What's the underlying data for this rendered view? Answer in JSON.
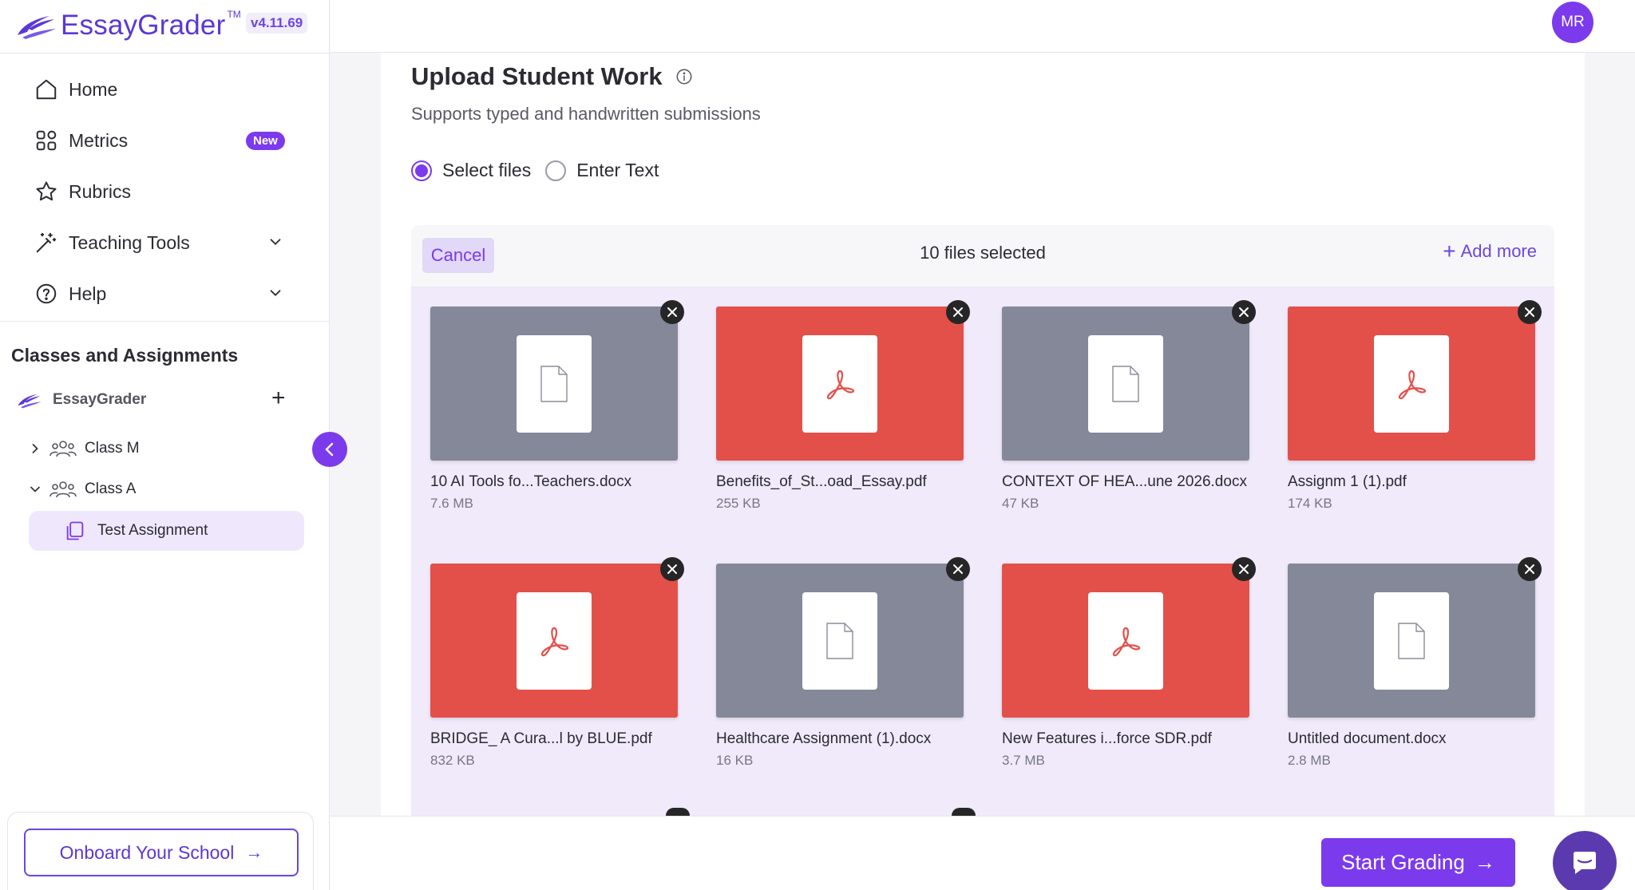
{
  "app": {
    "name": "EssayGrader",
    "trademark": "TM",
    "version": "v4.11.69",
    "brand_color": "#7c3aed"
  },
  "user": {
    "initials": "MR"
  },
  "sidebar": {
    "nav": [
      {
        "label": "Home",
        "icon": "home-icon"
      },
      {
        "label": "Metrics",
        "icon": "grid-icon",
        "badge": "New"
      },
      {
        "label": "Rubrics",
        "icon": "star-icon"
      },
      {
        "label": "Teaching Tools",
        "icon": "magic-wand-icon",
        "expandable": true
      },
      {
        "label": "Help",
        "icon": "help-circle-icon",
        "expandable": true
      }
    ],
    "classes_title": "Classes and Assignments",
    "tree_root": "EssayGrader",
    "classes": [
      {
        "label": "Class M",
        "expanded": false
      },
      {
        "label": "Class A",
        "expanded": true
      }
    ],
    "active_assignment": "Test Assignment",
    "onboard_label": "Onboard Your School"
  },
  "main": {
    "title": "Upload Student Work",
    "subtitle": "Supports typed and handwritten submissions",
    "radio_options": [
      {
        "label": "Select files",
        "selected": true
      },
      {
        "label": "Enter Text",
        "selected": false
      }
    ],
    "files_panel": {
      "cancel_label": "Cancel",
      "selected_text": "10 files selected",
      "add_more_label": "Add more"
    },
    "files": [
      {
        "name": "10 AI Tools fo...Teachers.docx",
        "size": "7.6 MB",
        "kind": "doc"
      },
      {
        "name": "Benefits_of_St...oad_Essay.pdf",
        "size": "255 KB",
        "kind": "pdf"
      },
      {
        "name": "CONTEXT OF HEA...une 2026.docx",
        "size": "47 KB",
        "kind": "doc"
      },
      {
        "name": "Assignm 1 (1).pdf",
        "size": "174 KB",
        "kind": "pdf"
      },
      {
        "name": "BRIDGE_ A Cura...l by BLUE.pdf",
        "size": "832 KB",
        "kind": "pdf"
      },
      {
        "name": "Healthcare Assignment (1).docx",
        "size": "16 KB",
        "kind": "doc"
      },
      {
        "name": "New Features i...force SDR.pdf",
        "size": "3.7 MB",
        "kind": "pdf"
      },
      {
        "name": "Untitled document.docx",
        "size": "2.8 MB",
        "kind": "doc"
      }
    ]
  },
  "footer": {
    "start_label": "Start Grading"
  }
}
